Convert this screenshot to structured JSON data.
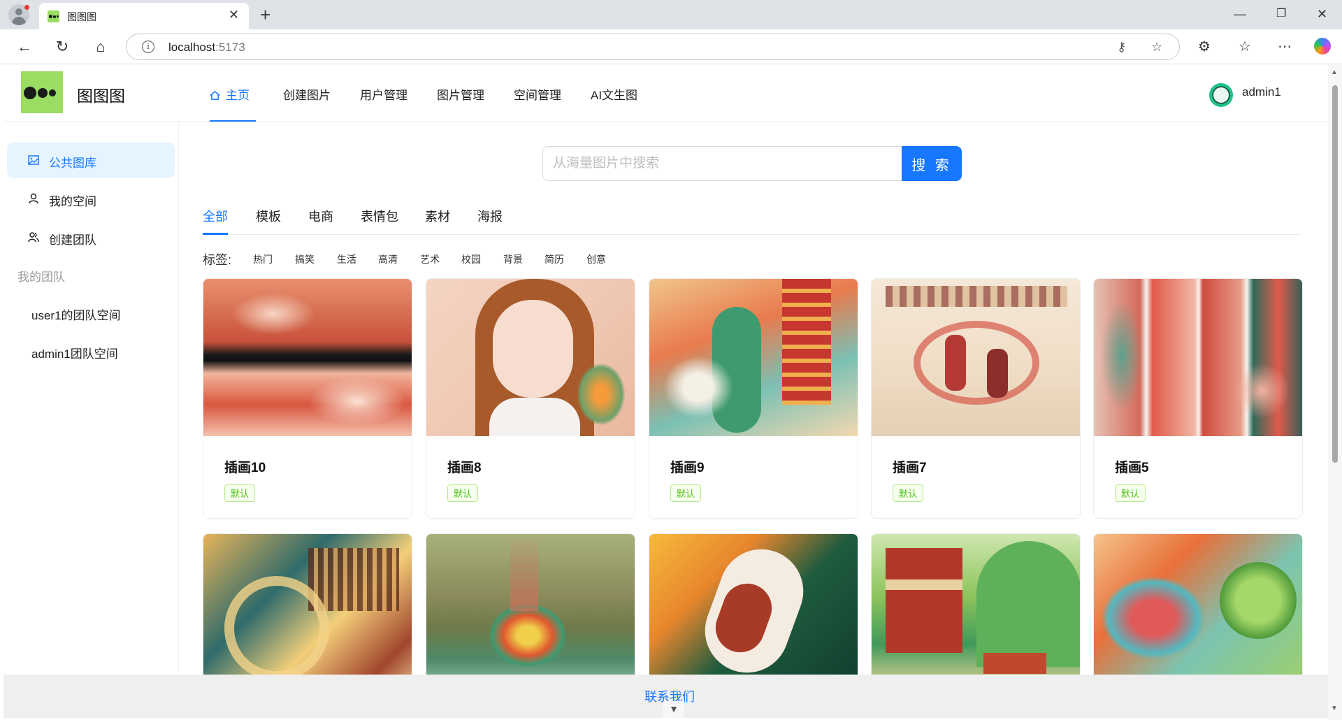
{
  "browser": {
    "tab_title": "图图图",
    "tab_close": "✕",
    "new_tab": "+",
    "url_host": "localhost",
    "url_port": ":5173",
    "window_controls": [
      "—",
      "❐",
      "✕"
    ]
  },
  "header": {
    "app_title": "图图图",
    "menu": [
      "主页",
      "创建图片",
      "用户管理",
      "图片管理",
      "空间管理",
      "AI文生图"
    ],
    "user_name": "admin1"
  },
  "sidebar": {
    "items": [
      "公共图库",
      "我的空间",
      "创建团队"
    ],
    "group_title": "我的团队",
    "teams": [
      "user1的团队空间",
      "admin1团队空间"
    ]
  },
  "search": {
    "placeholder": "从海量图片中搜索",
    "button": "搜 索"
  },
  "categories": [
    "全部",
    "模板",
    "电商",
    "表情包",
    "素材",
    "海报"
  ],
  "tags": {
    "label": "标签:",
    "items": [
      "热门",
      "搞笑",
      "生活",
      "高清",
      "艺术",
      "校园",
      "背景",
      "简历",
      "创意"
    ]
  },
  "cards": [
    {
      "title": "插画10",
      "badge": "默认"
    },
    {
      "title": "插画8",
      "badge": "默认"
    },
    {
      "title": "插画9",
      "badge": "默认"
    },
    {
      "title": "插画7",
      "badge": "默认"
    },
    {
      "title": "插画5",
      "badge": "默认"
    }
  ],
  "footer": {
    "link": "联系我们",
    "arrow": "▼"
  },
  "colors": {
    "accent": "#1677ff",
    "logo_bg": "#9bdc63",
    "badge_green": "#52c41a",
    "active_bg": "#e6f4ff"
  }
}
